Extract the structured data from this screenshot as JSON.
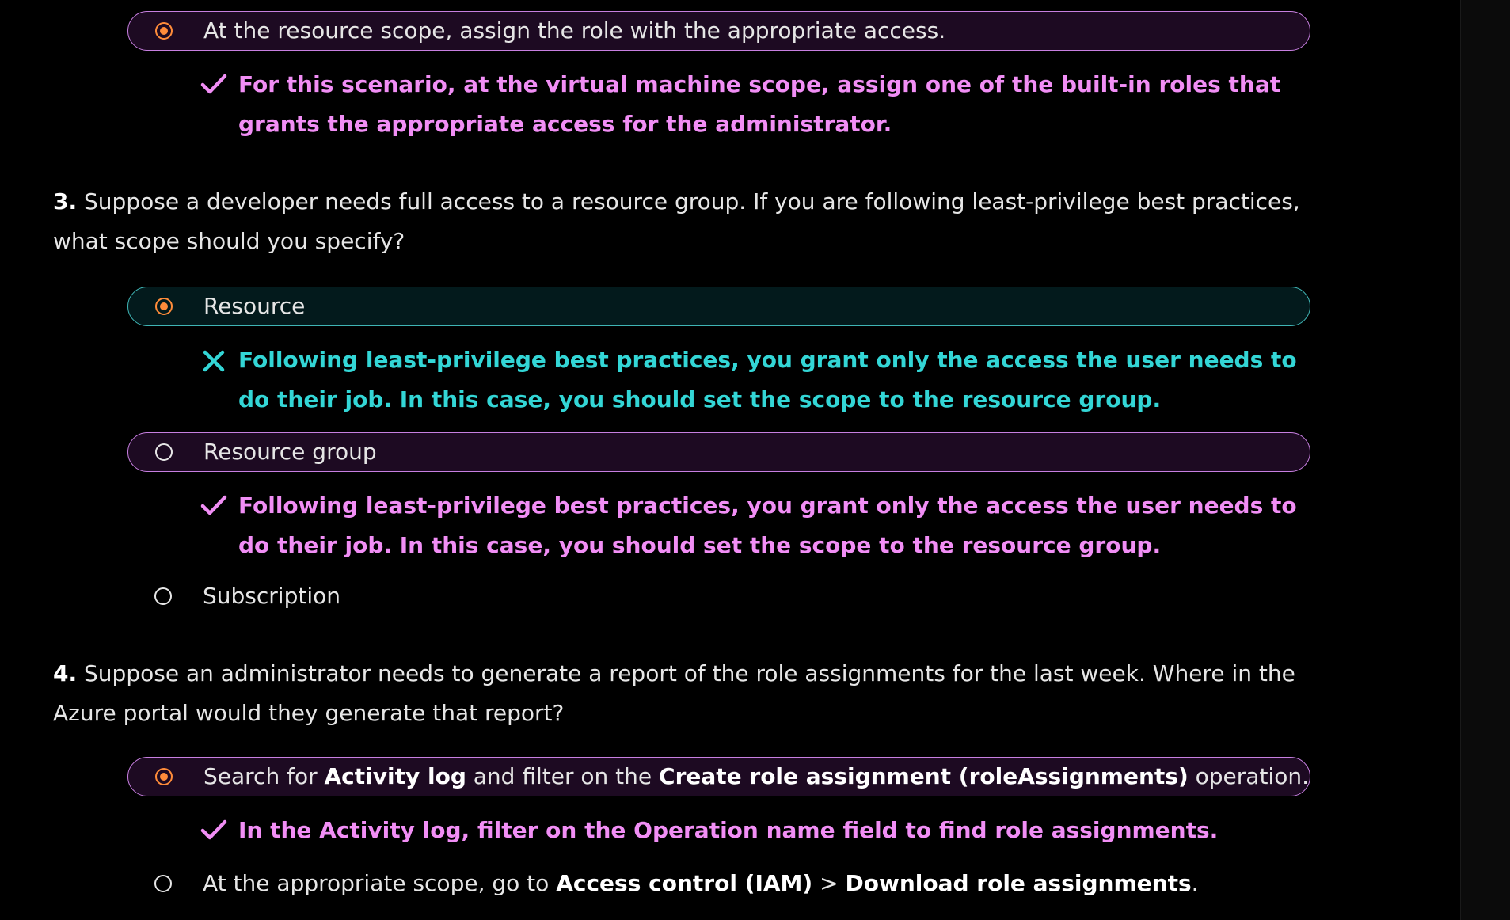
{
  "colors": {
    "accent_correct": "#f18ef5",
    "accent_wrong": "#33d6d6",
    "radio_selected": "#ff8c3a",
    "background": "#000000"
  },
  "q2": {
    "selected_option": {
      "label": "At the resource scope, assign the role with the appropriate access.",
      "feedback": "For this scenario, at the virtual machine scope, assign one of the built-in roles that grants the appropriate access for the administrator."
    }
  },
  "q3": {
    "number": "3.",
    "text": "Suppose a developer needs full access to a resource group. If you are following least-privilege best practices, what scope should you specify?",
    "options": [
      {
        "label": "Resource",
        "feedback": "Following least-privilege best practices, you grant only the access the user needs to do their job. In this case, you should set the scope to the resource group."
      },
      {
        "label": "Resource group",
        "feedback": "Following least-privilege best practices, you grant only the access the user needs to do their job. In this case, you should set the scope to the resource group."
      },
      {
        "label": "Subscription"
      }
    ]
  },
  "q4": {
    "number": "4.",
    "text": "Suppose an administrator needs to generate a report of the role assignments for the last week. Where in the Azure portal would they generate that report?",
    "options": [
      {
        "parts": [
          "Search for ",
          "Activity log",
          " and filter on the ",
          "Create role assignment (roleAssignments)",
          " operation."
        ],
        "feedback": "In the Activity log, filter on the Operation name field to find role assignments."
      },
      {
        "parts": [
          "At the appropriate scope, go to ",
          "Access control (IAM)",
          " > ",
          "Download role assignments",
          "."
        ]
      }
    ]
  }
}
